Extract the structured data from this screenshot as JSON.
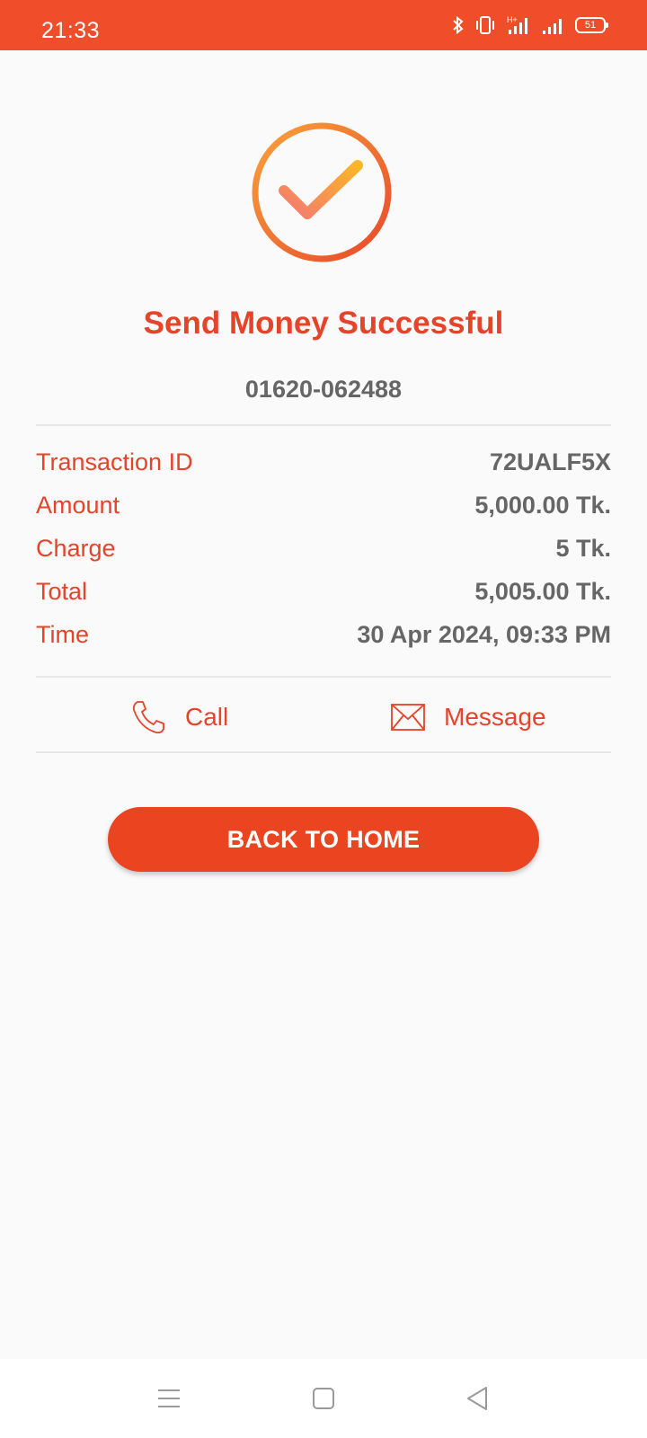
{
  "status_bar": {
    "time": "21:33",
    "battery": "51",
    "icons": [
      "bluetooth-icon",
      "vibrate-icon",
      "signal-hplus-icon",
      "signal-icon",
      "battery-icon"
    ]
  },
  "result": {
    "icon": "success-check-icon",
    "title": "Send Money Successful",
    "recipient": "01620-062488"
  },
  "details": [
    {
      "label": "Transaction ID",
      "value": "72UALF5X"
    },
    {
      "label": "Amount",
      "value": "5,000.00 Tk."
    },
    {
      "label": "Charge",
      "value": "5 Tk."
    },
    {
      "label": "Total",
      "value": "5,005.00 Tk."
    },
    {
      "label": "Time",
      "value": "30 Apr 2024, 09:33 PM"
    }
  ],
  "actions": {
    "call": {
      "label": "Call",
      "icon": "phone-icon"
    },
    "message": {
      "label": "Message",
      "icon": "envelope-icon"
    }
  },
  "home_button": {
    "label": "BACK TO HOME"
  },
  "nav_bar": {
    "icons": [
      "menu-icon",
      "home-square-icon",
      "back-triangle-icon"
    ]
  },
  "colors": {
    "brand": "#f04e2b",
    "accent_text": "#e5432a",
    "button": "#ea4420",
    "value_text": "#666666",
    "background": "#fafafa"
  }
}
